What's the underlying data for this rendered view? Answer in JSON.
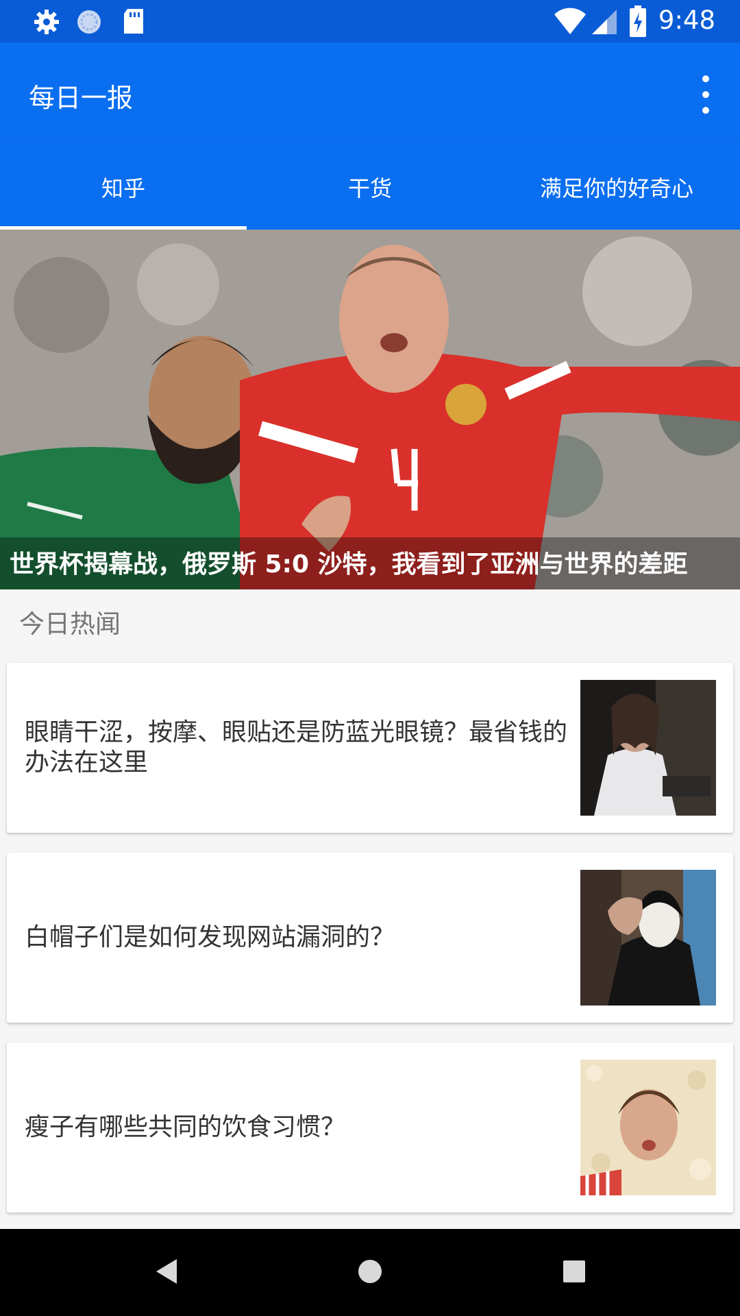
{
  "status_bar": {
    "time": "9:48"
  },
  "app_bar": {
    "title": "每日一报"
  },
  "tabs": [
    "知乎",
    "干货",
    "满足你的好奇心"
  ],
  "hero": {
    "caption": "世界杯揭幕战，俄罗斯 5:0 沙特，我看到了亚洲与世界的差距"
  },
  "section": {
    "title": "今日热闻"
  },
  "articles": [
    {
      "title": "眼睛干涩，按摩、眼贴还是防蓝光眼镜？最省钱的办法在这里"
    },
    {
      "title": "白帽子们是如何发现网站漏洞的？"
    },
    {
      "title": "瘦子有哪些共同的饮食习惯？"
    }
  ],
  "colors": {
    "status_bar": "#0a5cd6",
    "primary": "#0a6ef0"
  }
}
